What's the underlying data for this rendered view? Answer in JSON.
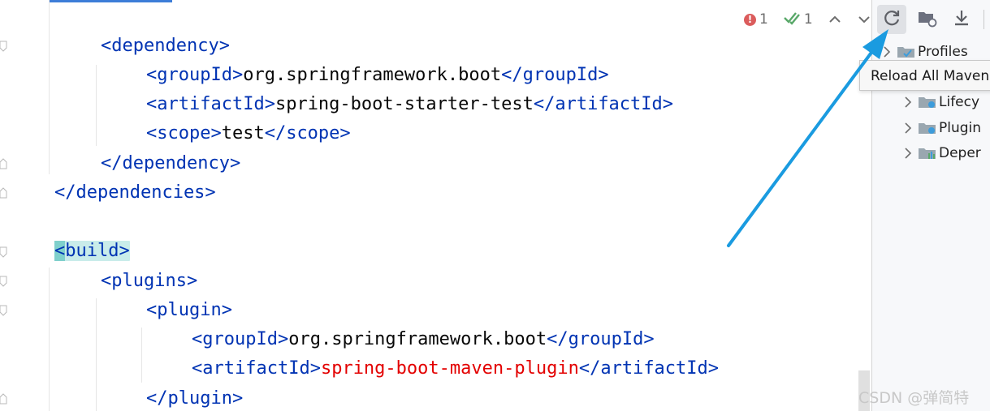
{
  "inspection": {
    "error_count": "1",
    "ok_count": "1"
  },
  "code_lines": [
    {
      "tag_open": "<dependency>"
    },
    {
      "open": "<groupId>",
      "text": "org.springframework.boot",
      "close": "</groupId>"
    },
    {
      "open": "<artifactId>",
      "text": "spring-boot-starter-test",
      "close": "</artifactId>"
    },
    {
      "open": "<scope>",
      "text": "test",
      "close": "</scope>"
    },
    {
      "tag_close": "</dependency>"
    },
    {
      "tag_close": "</dependencies>"
    },
    {
      "build_lt": "<",
      "build_name": "build",
      "build_gt": ">"
    },
    {
      "tag_open": "<plugins>"
    },
    {
      "tag_open": "<plugin>"
    },
    {
      "open": "<groupId>",
      "text": "org.springframework.boot",
      "close": "</groupId>"
    },
    {
      "open": "<artifactId>",
      "text": "spring-boot-maven-plugin",
      "close": "</artifactId>"
    },
    {
      "tag_close": "</plugin>"
    }
  ],
  "maven_panel": {
    "toolbar": {
      "reload_icon": "reload-icon",
      "generate_sources_icon": "folder-reload-icon",
      "download_icon": "download-icon"
    },
    "tooltip": "Reload All Maven",
    "tree": [
      {
        "label": "Profiles"
      },
      {
        "label": "Lifecy"
      },
      {
        "label": "Plugin"
      },
      {
        "label": "Deper"
      }
    ]
  },
  "watermark": "CSDN @弹简特",
  "colors": {
    "tag": "#0033b3",
    "text": "#080808",
    "plugin_highlight": "#e30000",
    "arrow": "#1a9be0",
    "build_highlight": "#c9ecea"
  }
}
